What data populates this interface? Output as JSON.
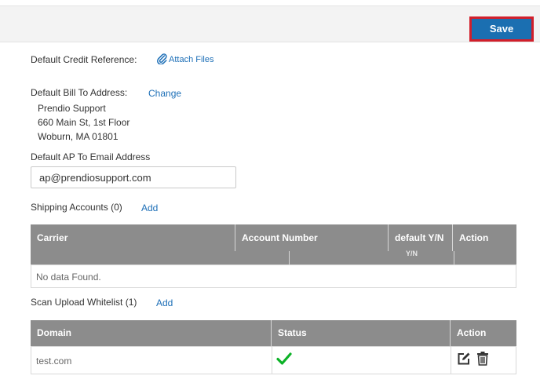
{
  "toolbar": {
    "save_label": "Save"
  },
  "credit": {
    "label": "Default Credit Reference:",
    "attach_label": "Attach Files"
  },
  "bill_to": {
    "label": "Default Bill To Address:",
    "change_label": "Change",
    "lines": [
      "Prendio Support",
      "660 Main St, 1st Floor",
      "Woburn, MA 01801"
    ]
  },
  "ap_email": {
    "label": "Default AP To Email Address",
    "value": "ap@prendiosupport.com"
  },
  "shipping": {
    "title": "Shipping Accounts (0)",
    "add_label": "Add",
    "columns": [
      "Carrier",
      "Account Number",
      "default Y/N",
      "Action"
    ],
    "filter_overflow_text": "Y/N",
    "empty_text": "No data Found."
  },
  "whitelist": {
    "title": "Scan Upload Whitelist (1)",
    "add_label": "Add",
    "columns": [
      "Domain",
      "Status",
      "Action"
    ],
    "rows": [
      {
        "domain": "test.com",
        "status_icon": "checkmark-icon"
      }
    ]
  },
  "colors": {
    "accent": "#1b6fb1",
    "highlight": "#d11f2b",
    "link": "#1d6fb7",
    "header_bg": "#8c8c8c",
    "status_ok": "#0cb227"
  },
  "icons": {
    "attach": "paperclip-icon",
    "edit": "edit-icon",
    "delete": "trash-icon"
  }
}
